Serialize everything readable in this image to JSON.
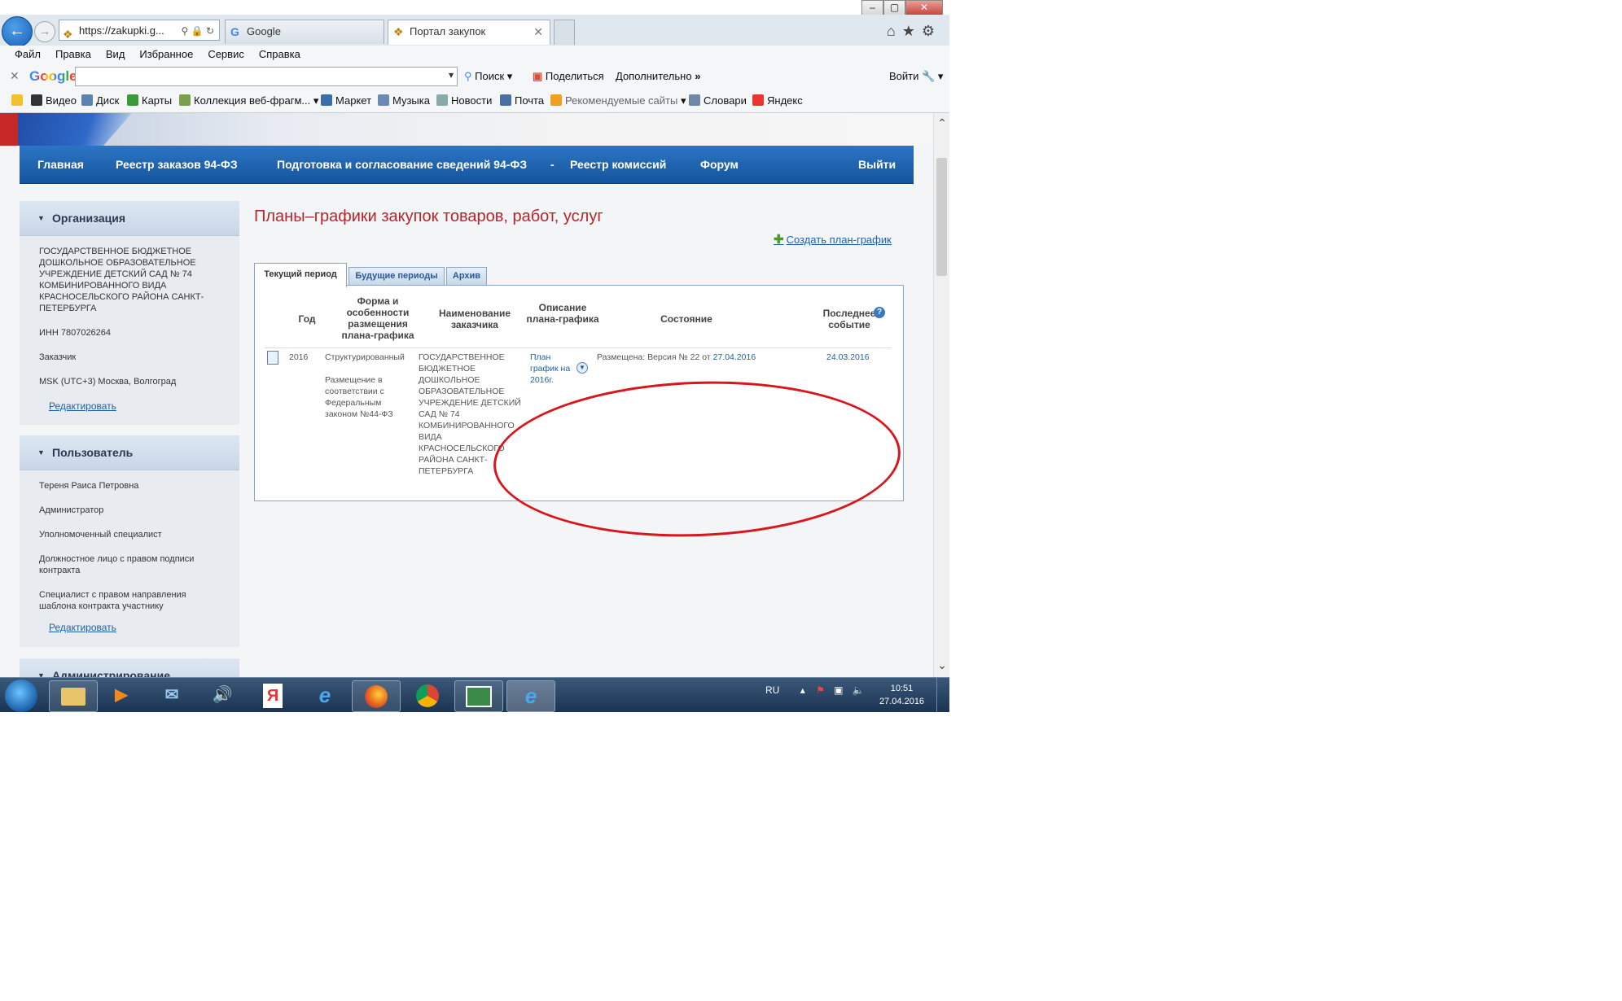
{
  "browser": {
    "window_controls": [
      "–",
      "▢",
      "✕"
    ],
    "address": "https://zakupki.g...",
    "address_icons": [
      "search-icon",
      "lock-icon",
      "refresh-icon"
    ],
    "tabs": [
      {
        "label": "Google",
        "active": false
      },
      {
        "label": "Портал закупок",
        "active": true
      }
    ],
    "tab_close": "✕",
    "toolbar_icons": [
      "home-icon",
      "favorites-star-icon",
      "settings-gear-icon"
    ]
  },
  "menu": [
    "Файл",
    "Правка",
    "Вид",
    "Избранное",
    "Сервис",
    "Справка"
  ],
  "google_toolbar": {
    "logo": "Google",
    "search_value": "",
    "search_label": "Поиск",
    "share_label": "Поделиться",
    "more_label": "Дополнительно",
    "login_label": "Войти"
  },
  "bookmarks": [
    "Видео",
    "Диск",
    "Карты",
    "Коллекция веб-фрагм...",
    "Маркет",
    "Музыка",
    "Новости",
    "Почта",
    "Рекомендуемые сайты",
    "Словари",
    "Яндекс"
  ],
  "nav": [
    "Главная",
    "Реестр заказов 94-ФЗ",
    "Подготовка и согласование сведений 94-ФЗ",
    "-",
    "Реестр комиссий",
    "Форум",
    "Выйти"
  ],
  "organization": {
    "title": "Организация",
    "name": "ГОСУДАРСТВЕННОЕ БЮДЖЕТНОЕ ДОШКОЛЬНОЕ ОБРАЗОВАТЕЛЬНОЕ УЧРЕЖДЕНИЕ ДЕТСКИЙ САД № 74 КОМБИНИРОВАННОГО ВИДА КРАСНОСЕЛЬСКОГО РАЙОНА САНКТ-ПЕТЕРБУРГА",
    "inn": "ИНН 7807026264",
    "role": "Заказчик",
    "timezone": "MSK (UTC+3) Москва, Волгоград",
    "edit": "Редактировать"
  },
  "user": {
    "title": "Пользователь",
    "name": "Тереня Раиса Петровна",
    "roles": [
      "Администратор",
      "Уполномоченный специалист",
      "Должностное лицо с правом подписи контракта",
      "Специалист с правом направления шаблона контракта участнику"
    ],
    "edit": "Редактировать"
  },
  "admin_panel_title": "Администрирование",
  "main": {
    "title": "Планы–графики закупок товаров, работ, услуг",
    "create_link": "Создать план-график",
    "tabs": [
      "Текущий период",
      "Будущие периоды",
      "Архив"
    ],
    "columns": [
      "Год",
      "Форма и особенности размещения плана-графика",
      "Наименование заказчика",
      "Описание плана-графика",
      "Состояние",
      "Последнее событие"
    ],
    "help": "?",
    "rows": [
      {
        "year": "2016",
        "form": "Структурированный",
        "placement": "Размещение в соответствии с Федеральным законом №44-ФЗ",
        "customer": "ГОСУДАРСТВЕННОЕ БЮДЖЕТНОЕ ДОШКОЛЬНОЕ ОБРАЗОВАТЕЛЬНОЕ УЧРЕЖДЕНИЕ ДЕТСКИЙ САД № 74 КОМБИНИРОВАННОГО ВИДА КРАСНОСЕЛЬСКОГО РАЙОНА САНКТ-ПЕТЕРБУРГА",
        "description": "План график на 2016г.",
        "status_text": "Размещена: Версия №  22 от",
        "status_date": "27.04.2016",
        "last_event": "24.03.2016"
      }
    ]
  },
  "taskbar": {
    "apps": [
      "explorer-icon",
      "media-player-icon",
      "mail-icon",
      "volume-app-icon",
      "yandex-icon",
      "ie-icon",
      "firefox-icon",
      "chrome-icon",
      "window-app-icon",
      "ie-active-icon"
    ],
    "lang": "RU",
    "time": "10:51",
    "date": "27.04.2016"
  },
  "colors": {
    "nav_blue": "#1f63b4",
    "title_red": "#b8242b",
    "link_blue": "#1f5fae",
    "annotation_red": "#d8161c"
  }
}
